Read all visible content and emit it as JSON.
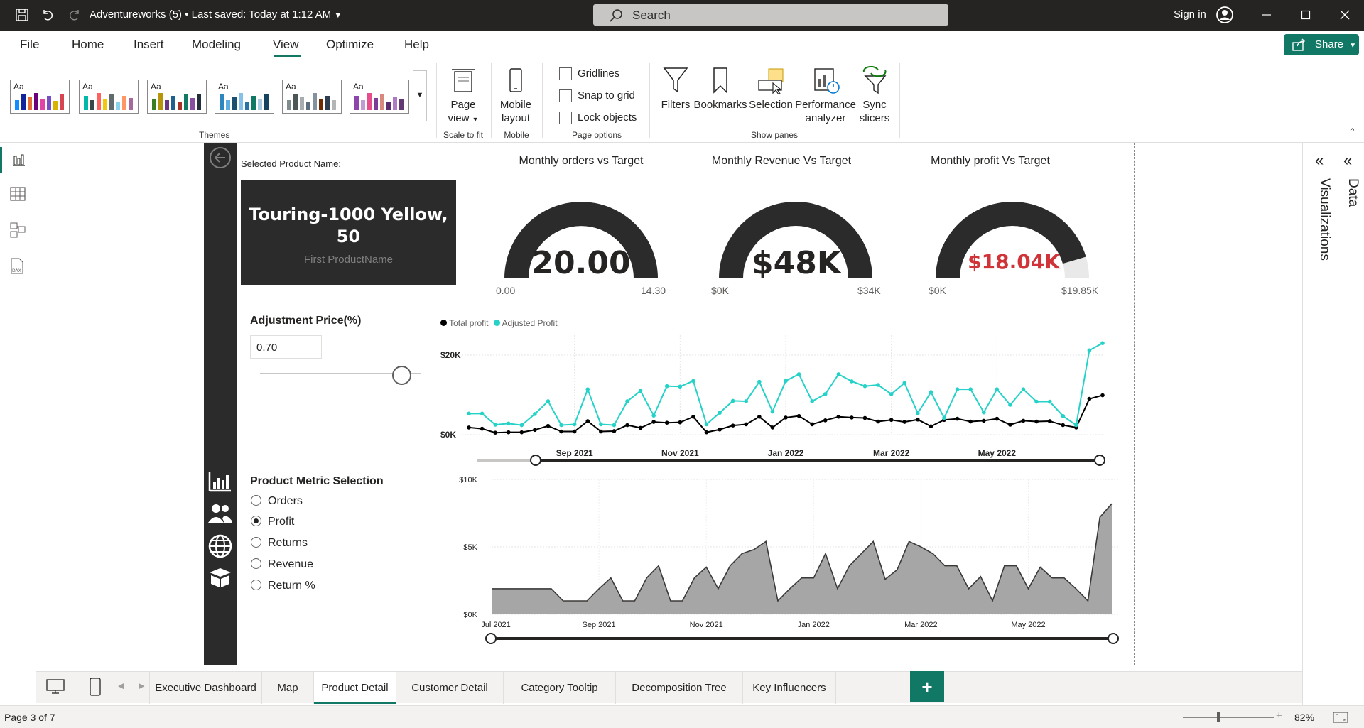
{
  "titlebar": {
    "doc_title": "Adventureworks (5)  •  Last saved: Today at 1:12 AM",
    "search_placeholder": "Search",
    "signin_label": "Sign in"
  },
  "menu": {
    "items": [
      "File",
      "Home",
      "Insert",
      "Modeling",
      "View",
      "Optimize",
      "Help"
    ],
    "active": "View",
    "share_label": "Share"
  },
  "ribbon": {
    "themes_label": "Themes",
    "scale_group": {
      "button": "Page view",
      "label": "Scale to fit"
    },
    "mobile_group": {
      "button": "Mobile layout",
      "label": "Mobile"
    },
    "page_options": {
      "gridlines": "Gridlines",
      "snap": "Snap to grid",
      "lock": "Lock objects",
      "label": "Page options"
    },
    "show_panes": {
      "filters": "Filters",
      "bookmarks": "Bookmarks",
      "selection": "Selection",
      "performance": "Performance analyzer",
      "sync": "Sync slicers",
      "label": "Show panes"
    }
  },
  "report": {
    "selected_label": "Selected Product Name:",
    "product_name": "Touring-1000 Yellow, 50",
    "product_sub": "First ProductName",
    "adjustment_title": "Adjustment Price(%)",
    "adjustment_value": "0.70",
    "adjustment_fraction": 0.88,
    "metric_title": "Product Metric Selection",
    "metrics": [
      "Orders",
      "Profit",
      "Returns",
      "Revenue",
      "Return %"
    ],
    "metric_selected": "Profit",
    "gauges": [
      {
        "title": "Monthly orders vs Target",
        "value": "20.00",
        "min": "0.00",
        "max": "14.30",
        "fill": 1.0,
        "color": "#252423"
      },
      {
        "title": "Monthly Revenue Vs Target",
        "value": "$48K",
        "min": "$0K",
        "max": "$34K",
        "fill": 1.0,
        "color": "#252423"
      },
      {
        "title": "Monthly profit Vs Target",
        "value": "$18.04K",
        "min": "$0K",
        "max": "$19.85K",
        "fill": 0.909,
        "color": "#d13438"
      }
    ]
  },
  "chart_data": [
    {
      "type": "line",
      "series": [
        {
          "name": "Total profit",
          "color": "#000000",
          "values": [
            1.8,
            1.5,
            0.5,
            0.6,
            0.6,
            1.2,
            2.2,
            0.8,
            0.8,
            3.4,
            0.8,
            0.9,
            2.4,
            1.7,
            3.2,
            3.0,
            3.1,
            4.5,
            0.6,
            1.3,
            2.3,
            2.6,
            4.5,
            1.8,
            4.3,
            4.7,
            2.6,
            3.6,
            4.5,
            4.3,
            4.2,
            3.3,
            3.7,
            3.2,
            3.8,
            2.1,
            3.7,
            4.0,
            3.3,
            3.5,
            4.0,
            2.5,
            3.5,
            3.3,
            3.4,
            2.4,
            1.8,
            9.0,
            9.9
          ]
        },
        {
          "name": "Adjusted Profit",
          "color": "#25d2c8",
          "values": [
            5.3,
            5.3,
            2.5,
            2.8,
            2.4,
            5.2,
            8.4,
            2.4,
            2.6,
            11.4,
            2.6,
            2.4,
            8.4,
            11.0,
            4.8,
            12.2,
            12.1,
            13.5,
            2.6,
            5.5,
            8.5,
            8.4,
            13.3,
            5.8,
            13.5,
            15.2,
            8.4,
            10.2,
            15.2,
            13.4,
            12.2,
            12.5,
            10.2,
            13.0,
            5.4,
            10.7,
            4.2,
            11.4,
            11.4,
            5.6,
            11.4,
            7.5,
            11.4,
            8.3,
            8.3,
            4.7,
            2.4,
            21.2,
            23.0
          ]
        }
      ],
      "x_ticks": [
        "Sep 2021",
        "Nov 2021",
        "Jan 2022",
        "Mar 2022",
        "May 2022"
      ],
      "y_ticks": [
        "$20K",
        "$0K"
      ],
      "ylim": [
        0,
        25
      ],
      "legend_position": "top-left",
      "grid": true
    },
    {
      "type": "area",
      "series": [
        {
          "name": "",
          "color": "#a6a6a6",
          "values": [
            1.9,
            1.9,
            1.9,
            1.9,
            1.9,
            1.9,
            1.0,
            1.0,
            1.0,
            1.9,
            2.7,
            1.0,
            1.0,
            2.7,
            3.6,
            1.0,
            1.0,
            2.7,
            3.5,
            1.9,
            3.6,
            4.5,
            4.8,
            5.4,
            1.0,
            1.9,
            2.7,
            2.7,
            4.5,
            1.9,
            3.6,
            4.5,
            5.4,
            2.6,
            3.3,
            5.4,
            5.0,
            4.5,
            3.6,
            3.6,
            1.9,
            2.8,
            1.0,
            3.6,
            3.6,
            1.9,
            3.5,
            2.7,
            2.7,
            1.9,
            1.0,
            7.2,
            8.2
          ]
        }
      ],
      "x_ticks": [
        "Jul 2021",
        "Sep 2021",
        "Nov 2021",
        "Jan 2022",
        "Mar 2022",
        "May 2022"
      ],
      "y_ticks": [
        "$10K",
        "$5K",
        "$0K"
      ],
      "ylim": [
        0,
        10
      ],
      "grid": true
    }
  ],
  "tabs": [
    "Executive Dashboard",
    "Map",
    "Product Detail",
    "Customer Detail",
    "Category Tooltip",
    "Decomposition Tree",
    "Key Influencers"
  ],
  "active_tab": "Product Detail",
  "panes": {
    "visualizations": "Visualizations",
    "data": "Data"
  },
  "status": {
    "page": "Page 3 of 7",
    "zoom": "82%"
  }
}
